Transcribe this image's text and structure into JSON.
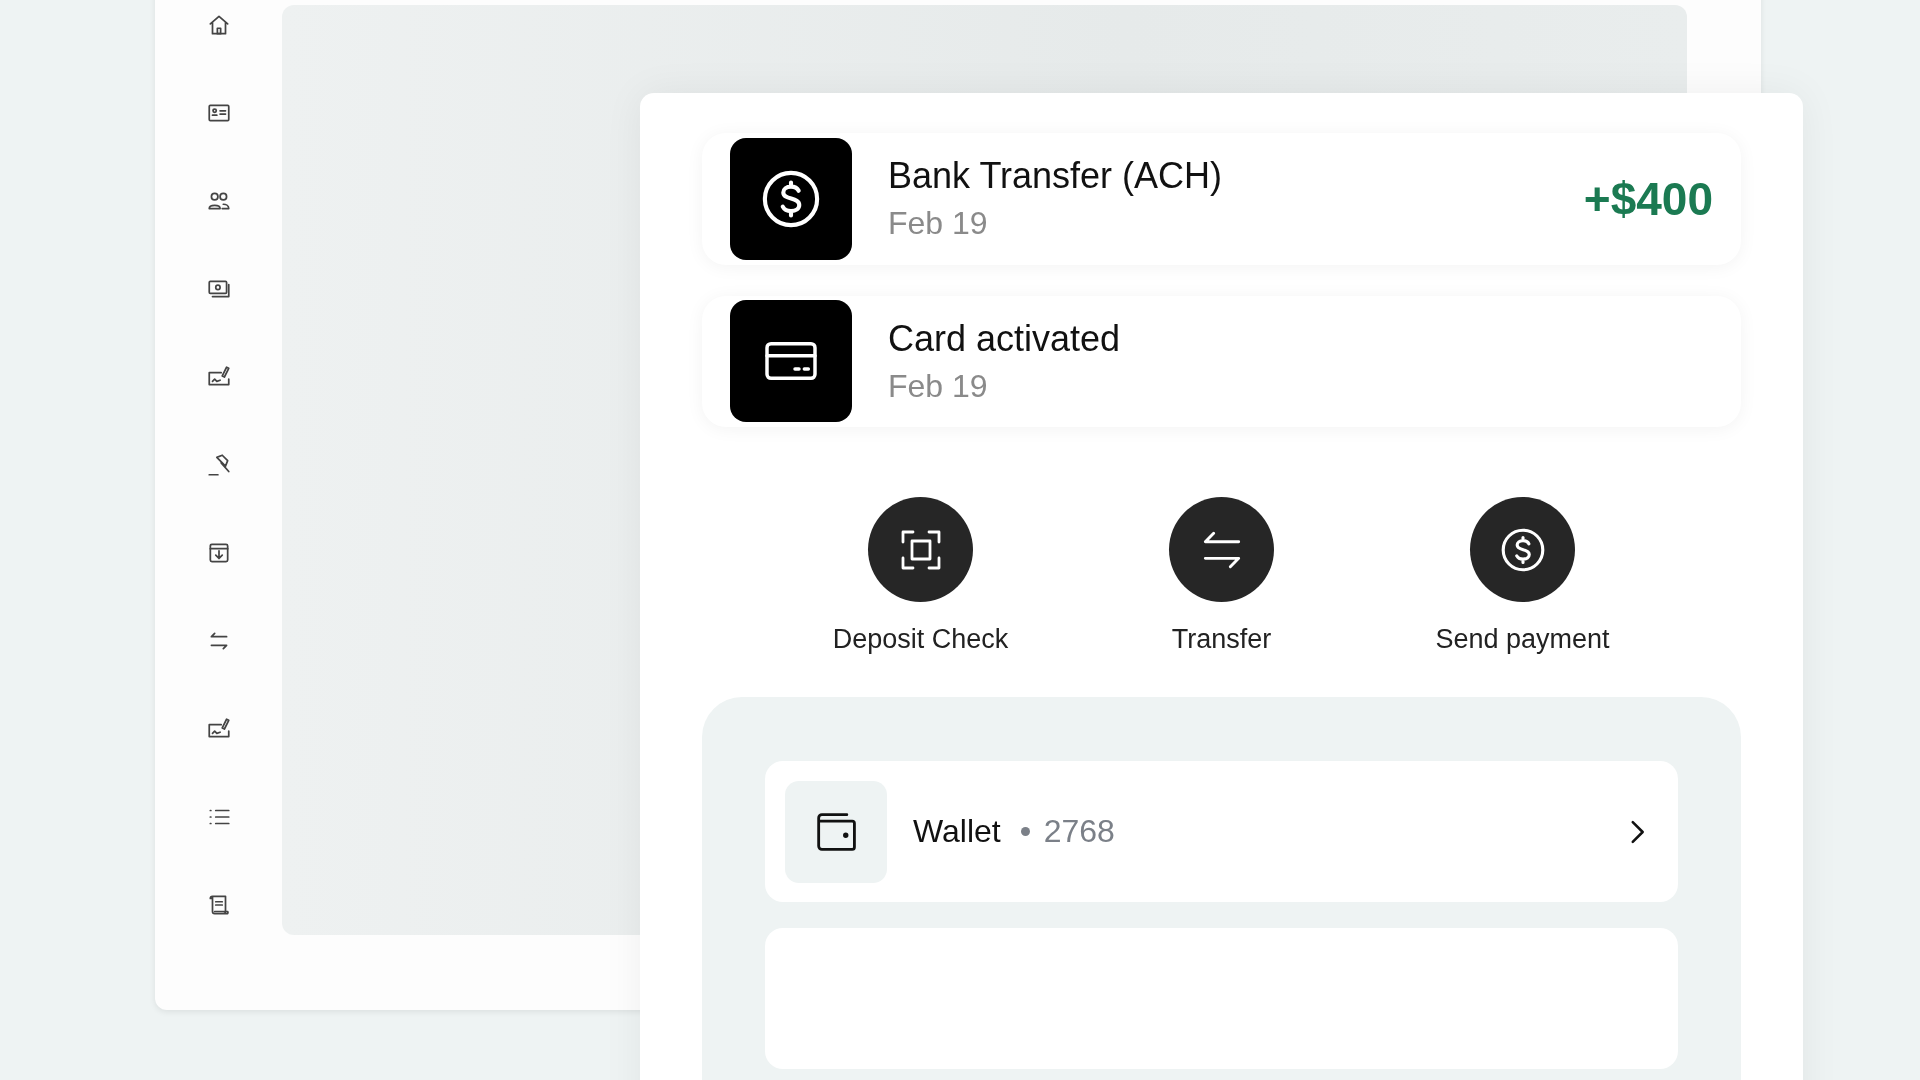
{
  "activity": [
    {
      "kind": "transfer",
      "title": "Bank Transfer (ACH)",
      "date": "Feb 19",
      "amount": "+$400"
    },
    {
      "kind": "card",
      "title": "Card activated",
      "date": "Feb 19"
    }
  ],
  "actions": [
    {
      "kind": "scan",
      "label": "Deposit Check"
    },
    {
      "kind": "transfer",
      "label": "Transfer"
    },
    {
      "kind": "payment",
      "label": "Send payment"
    }
  ],
  "accounts": [
    {
      "kind": "wallet",
      "name": "Wallet",
      "number": "2768"
    }
  ]
}
